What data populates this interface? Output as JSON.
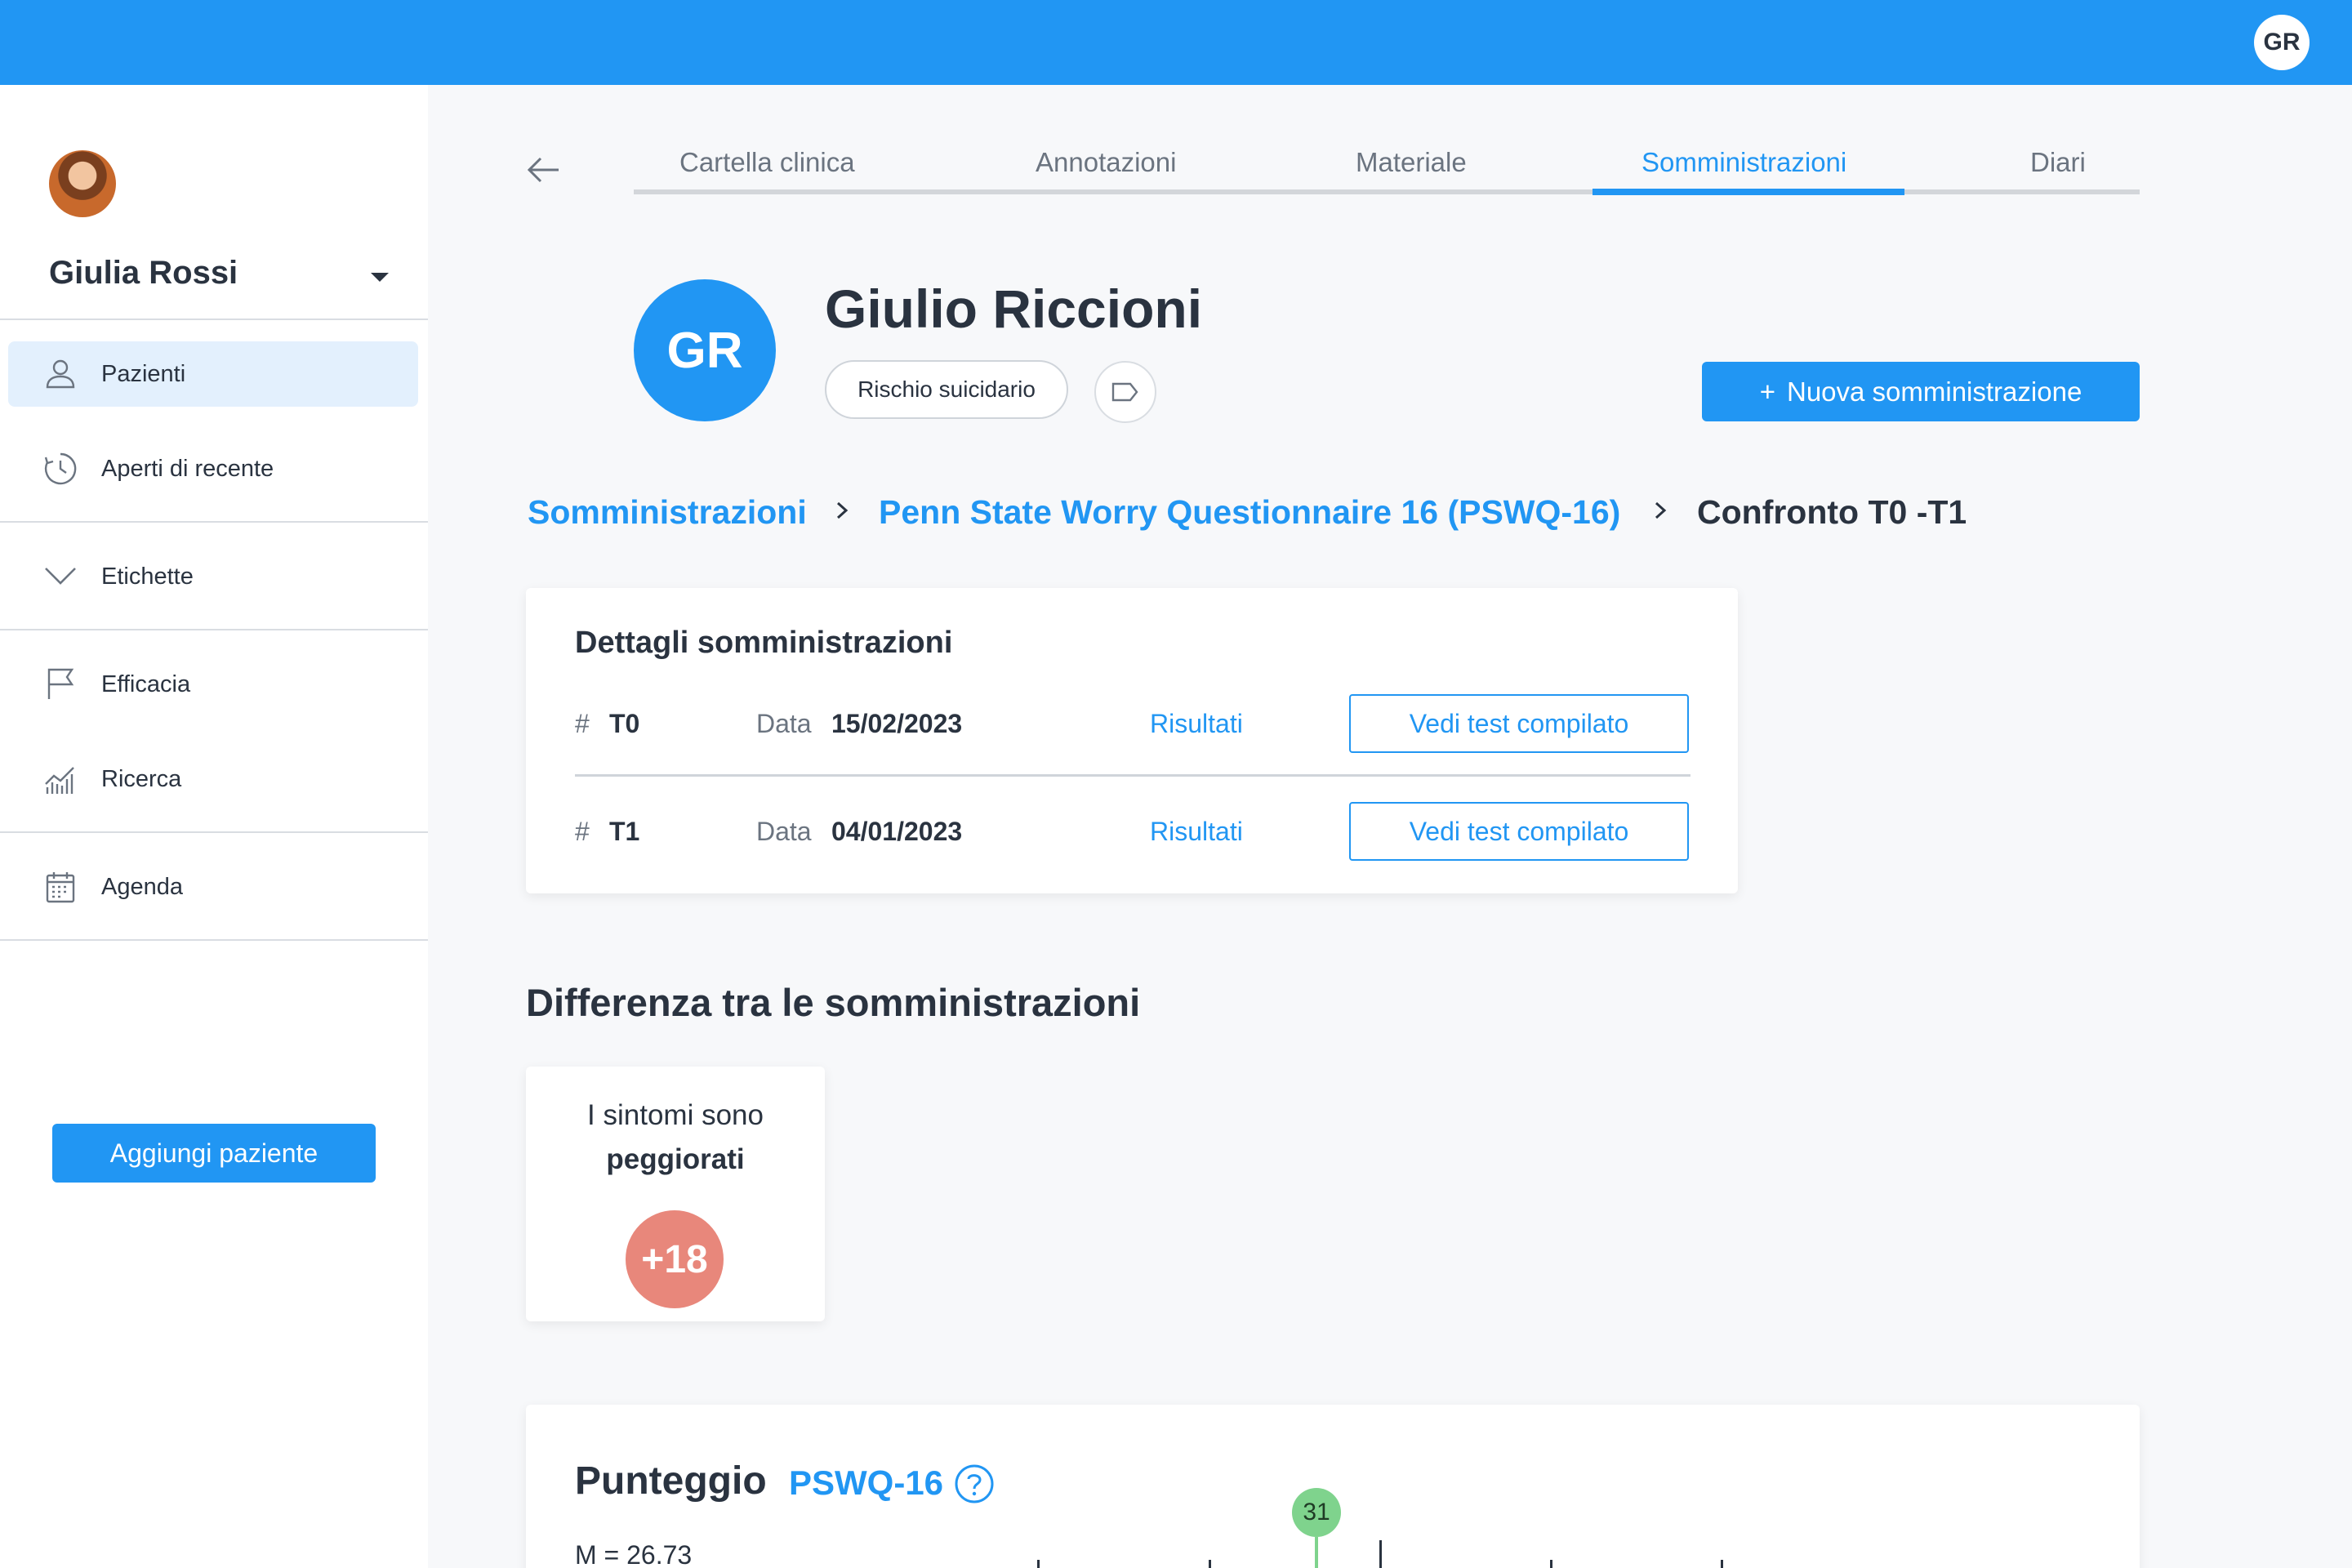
{
  "topbar": {
    "user_initials": "GR"
  },
  "sidebar": {
    "user_name": "Giulia Rossi",
    "items": [
      {
        "label": "Pazienti",
        "icon": "user-icon",
        "active": true
      },
      {
        "label": "Aperti di recente",
        "icon": "history-icon"
      },
      {
        "label": "Etichette",
        "icon": "chevron-down-icon"
      },
      {
        "label": "Efficacia",
        "icon": "flag-icon"
      },
      {
        "label": "Ricerca",
        "icon": "chart-icon"
      },
      {
        "label": "Agenda",
        "icon": "calendar-icon"
      }
    ],
    "add_patient_label": "Aggiungi paziente"
  },
  "tabs": [
    {
      "label": "Cartella clinica"
    },
    {
      "label": "Annotazioni"
    },
    {
      "label": "Materiale"
    },
    {
      "label": "Somministrazioni",
      "active": true
    },
    {
      "label": "Diari"
    }
  ],
  "patient": {
    "initials": "GR",
    "name": "Giulio Riccioni",
    "chip_label": "Rischio suicidario",
    "new_button_label": "Nuova somministrazione",
    "new_button_icon": "+"
  },
  "breadcrumb": {
    "items": [
      "Somministrazioni",
      "Penn State Worry Questionnaire 16 (PSWQ-16)",
      "Confronto T0 -T1"
    ]
  },
  "details": {
    "title": "Dettagli somministrazioni",
    "rows": [
      {
        "hash": "#",
        "id": "T0",
        "data_label": "Data",
        "date": "15/02/2023",
        "results_label": "Risultati",
        "button_label": "Vedi test compilato"
      },
      {
        "hash": "#",
        "id": "T1",
        "data_label": "Data",
        "date": "04/01/2023",
        "results_label": "Risultati",
        "button_label": "Vedi test compilato"
      }
    ]
  },
  "difference": {
    "title": "Differenza tra le somministrazioni",
    "text_line1": "I sintomi sono",
    "text_line2": "peggiorati",
    "value": "+18",
    "badge_color": "#e8877b"
  },
  "score": {
    "title": "Punteggio",
    "scale": "PSWQ-16",
    "mean_label": "M = 26.73",
    "marker_value": "31",
    "marker_color": "#7fd38d"
  },
  "colors": {
    "accent": "#2196f3",
    "text": "#2a3340"
  }
}
